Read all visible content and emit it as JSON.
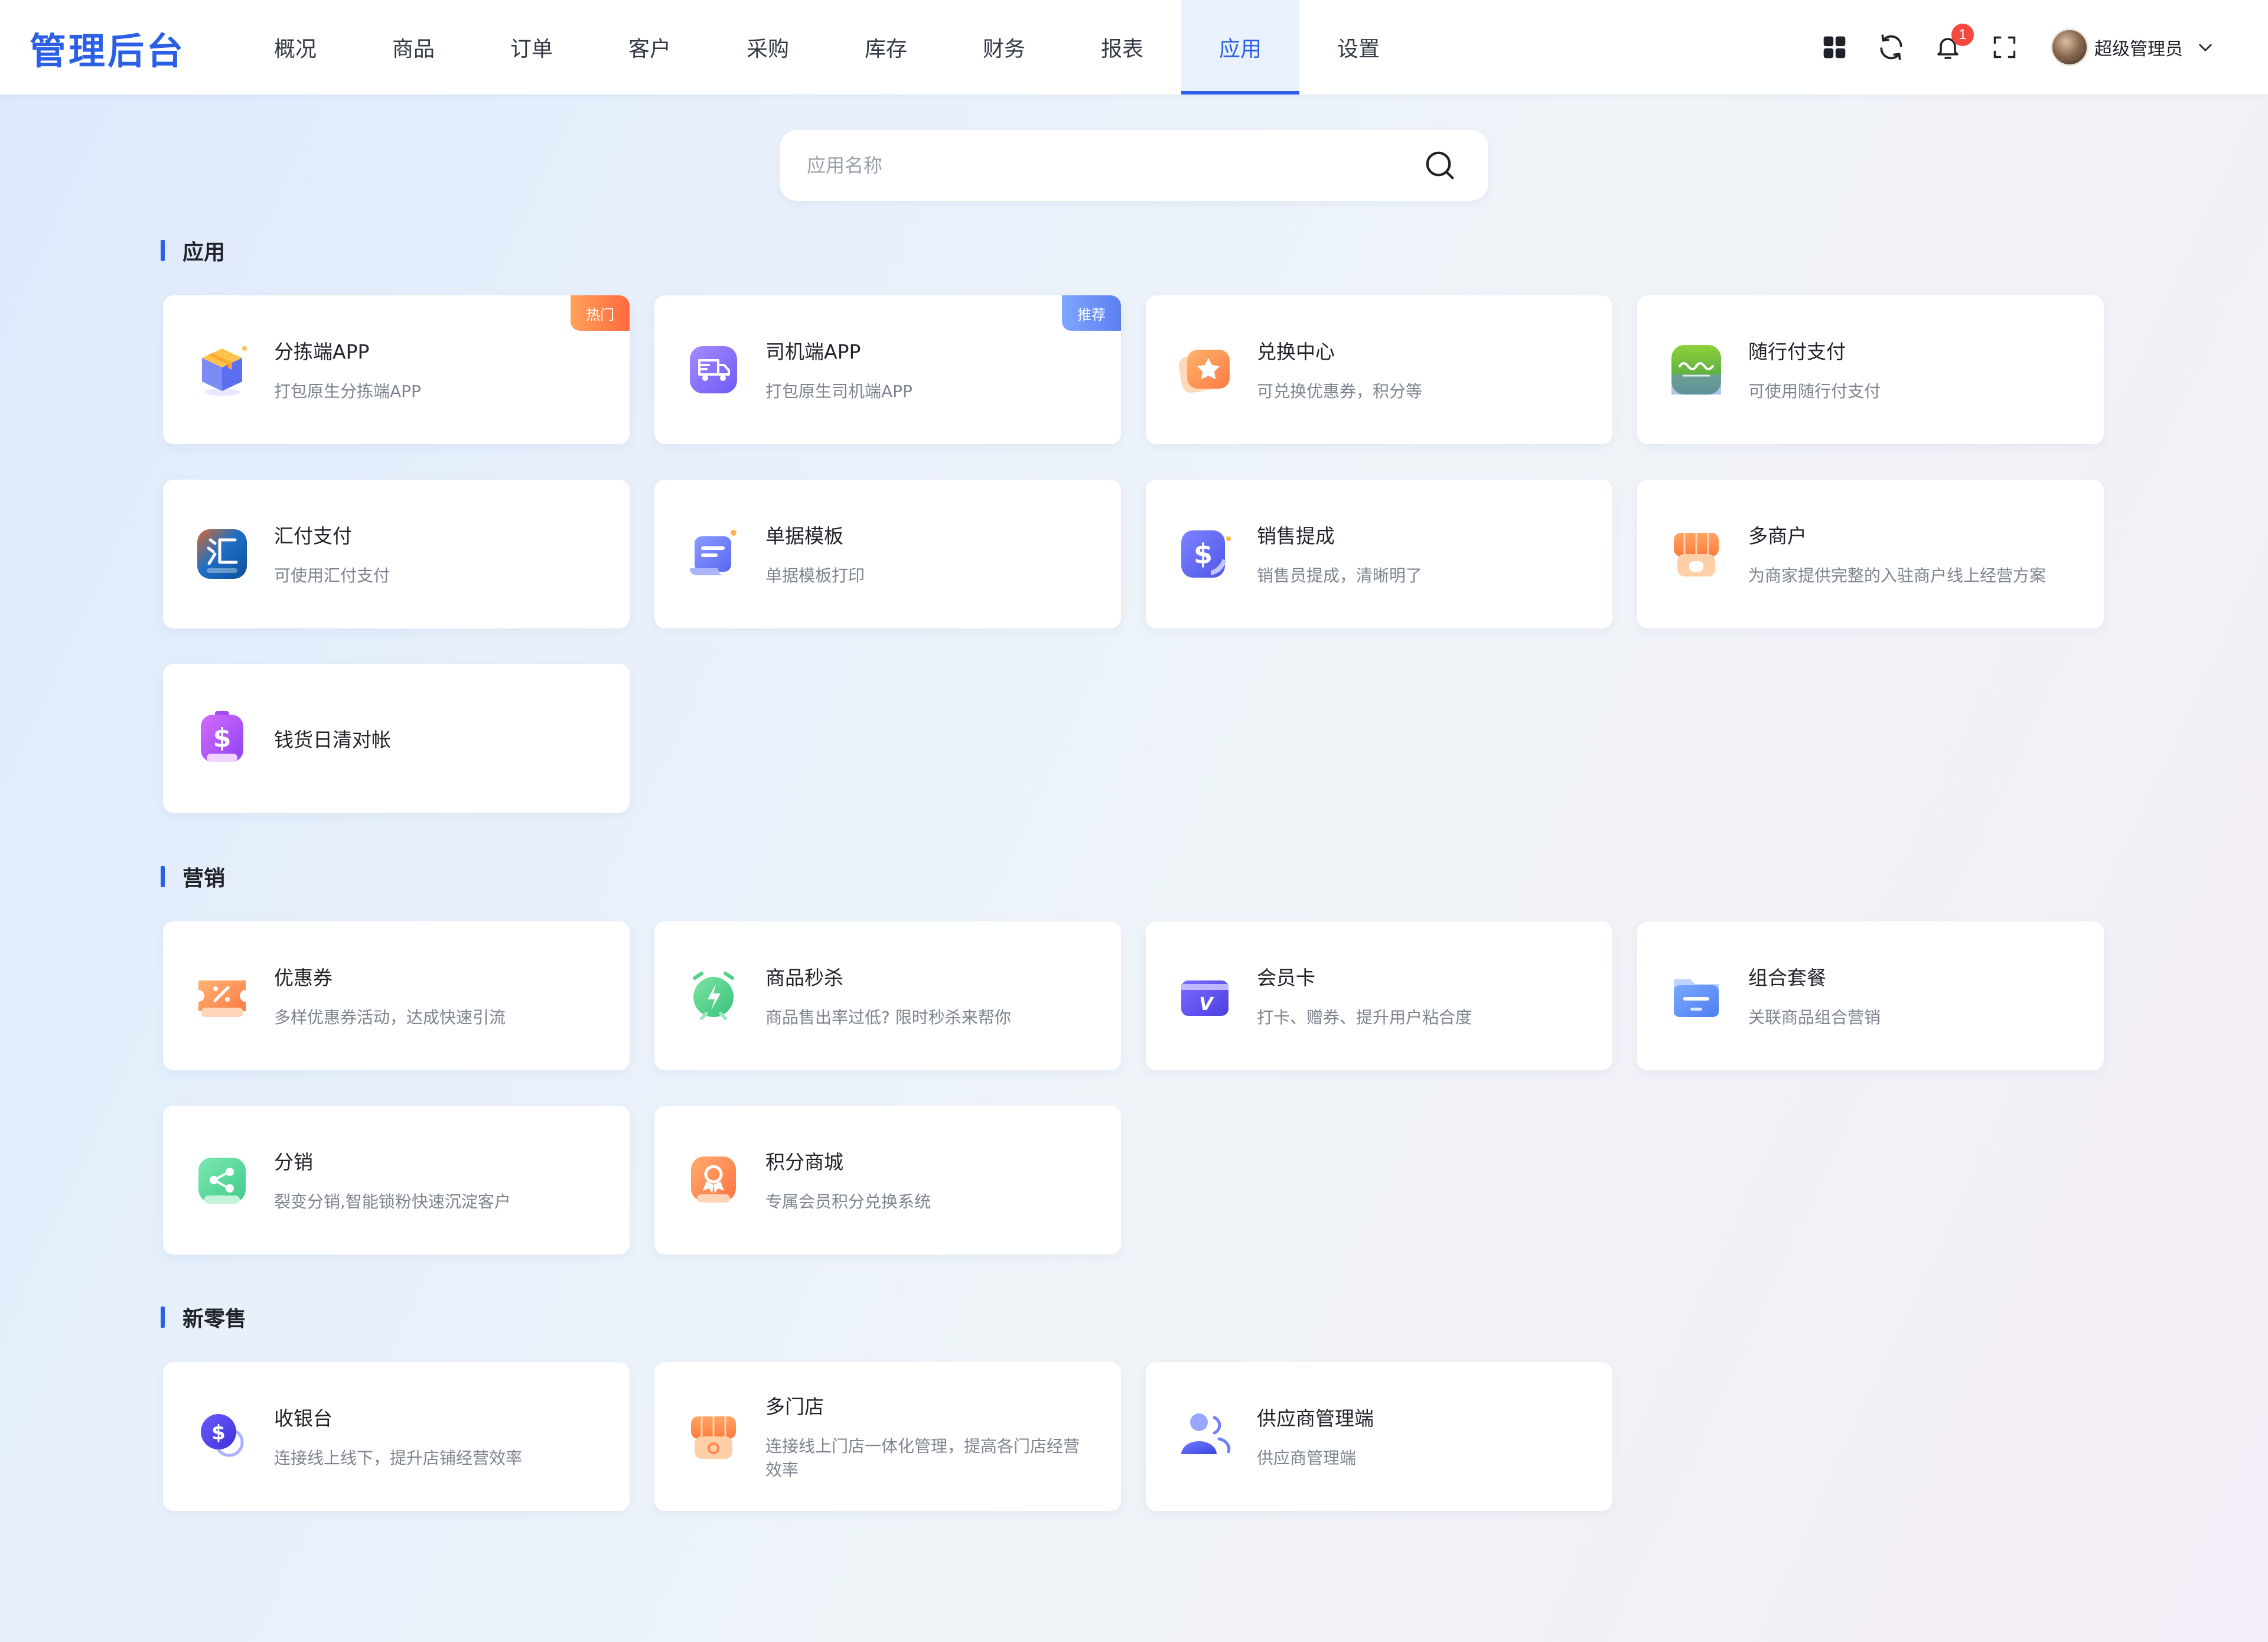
{
  "app": {
    "logo": "管理后台",
    "nav": [
      {
        "label": "概况"
      },
      {
        "label": "商品"
      },
      {
        "label": "订单"
      },
      {
        "label": "客户"
      },
      {
        "label": "采购"
      },
      {
        "label": "库存"
      },
      {
        "label": "财务"
      },
      {
        "label": "报表"
      },
      {
        "label": "应用",
        "active": true
      },
      {
        "label": "设置"
      }
    ],
    "notification_count": "1",
    "user_name": "超级管理员"
  },
  "search": {
    "placeholder": "应用名称",
    "value": ""
  },
  "sections": [
    {
      "title": "应用",
      "cards": [
        {
          "title": "分拣端APP",
          "desc": "打包原生分拣端APP",
          "tag": "热门",
          "icon": "package-box-icon"
        },
        {
          "title": "司机端APP",
          "desc": "打包原生司机端APP",
          "tag": "推荐",
          "icon": "delivery-truck-icon"
        },
        {
          "title": "兑换中心",
          "desc": "可兑换优惠券，积分等",
          "icon": "star-exchange-icon"
        },
        {
          "title": "随行付支付",
          "desc": "可使用随行付支付",
          "icon": "suixingfu-logo-icon"
        },
        {
          "title": "汇付支付",
          "desc": "可使用汇付支付",
          "icon": "huifu-logo-icon"
        },
        {
          "title": "单据模板",
          "desc": "单据模板打印",
          "icon": "document-template-icon"
        },
        {
          "title": "销售提成",
          "desc": "销售员提成，清晰明了",
          "icon": "commission-dollar-icon"
        },
        {
          "title": "多商户",
          "desc": "为商家提供完整的入驻商户线上经营方案",
          "icon": "storefront-icon"
        },
        {
          "title": "钱货日清对帐",
          "desc": "",
          "icon": "dollar-reconcile-icon"
        }
      ]
    },
    {
      "title": "营销",
      "cards": [
        {
          "title": "优惠券",
          "desc": "多样优惠券活动，达成快速引流",
          "icon": "coupon-icon"
        },
        {
          "title": "商品秒杀",
          "desc": "商品售出率过低? 限时秒杀来帮你",
          "icon": "flash-sale-clock-icon"
        },
        {
          "title": "会员卡",
          "desc": "打卡、赠券、提升用户粘合度",
          "icon": "member-card-icon"
        },
        {
          "title": "组合套餐",
          "desc": "关联商品组合营销",
          "icon": "bundle-folder-icon"
        },
        {
          "title": "分销",
          "desc": "裂变分销,智能锁粉快速沉淀客户",
          "icon": "share-network-icon"
        },
        {
          "title": "积分商城",
          "desc": "专属会员积分兑换系统",
          "icon": "points-mall-icon"
        }
      ]
    },
    {
      "title": "新零售",
      "cards": [
        {
          "title": "收银台",
          "desc": "连接线上线下，提升店铺经营效率",
          "icon": "cashier-coin-icon"
        },
        {
          "title": "多门店",
          "desc": "连接线上门店一体化管理，提高各门店经营效率",
          "icon": "multi-store-icon"
        },
        {
          "title": "供应商管理端",
          "desc": "供应商管理端",
          "icon": "supplier-users-icon"
        }
      ]
    }
  ],
  "colors": {
    "primary": "#2a5fe6",
    "badge": "#f5493f",
    "hot_tag": "#ff6a3d",
    "recommend_tag": "#5b7ff2"
  }
}
